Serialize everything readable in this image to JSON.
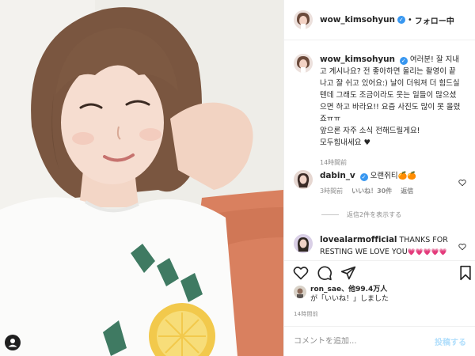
{
  "post": {
    "username": "wow_kimsohyun",
    "verified_icon": "verified-badge-icon",
    "follow_separator": "•",
    "follow_label": "フォロー中"
  },
  "caption": {
    "username": "wow_kimsohyun",
    "text": "여러분! 잘 지내고 계시나요? 전 좋아하면 울리는 촬영이 끝나고 잘 쉬고 있어요:) 날이 더워져 더 힘드실텐데 그래도 조금이라도 웃는 일들이 많으셨으면 하고 바라요!! 요즘 사진도 많이 못 올렸죠ㅠㅠ",
    "line2": "앞으론 자주 소식 전해드릴게요!",
    "line3": "모두힘내세요",
    "heart": "♥",
    "time": "14時間前"
  },
  "comments": [
    {
      "username": "dabin_v",
      "text": "오랜쥐티",
      "emoji": "🍊🍊",
      "time": "3時間前",
      "likes": "いいね！30件",
      "reply": "返信"
    },
    {
      "username": "lovealarmofficial",
      "text": "THANKS FOR RESTING WE LOVE YOU",
      "emoji": "💗💗💗💗💗"
    }
  ],
  "replies_label": "返信2件を表示する",
  "likes": {
    "line1": "ron_sae、他99.4万人",
    "line2": "が「いいね！」しました"
  },
  "time_ago": "14時間前",
  "comment_box": {
    "placeholder": "コメントを追加...",
    "post_label": "投稿する"
  },
  "colors": {
    "link_blue": "#3897f0",
    "post_disabled": "#b2dffc",
    "muted": "#8e8e8e"
  },
  "icons": [
    "heart-icon",
    "comment-icon",
    "share-icon",
    "bookmark-icon",
    "user-tag-icon"
  ]
}
